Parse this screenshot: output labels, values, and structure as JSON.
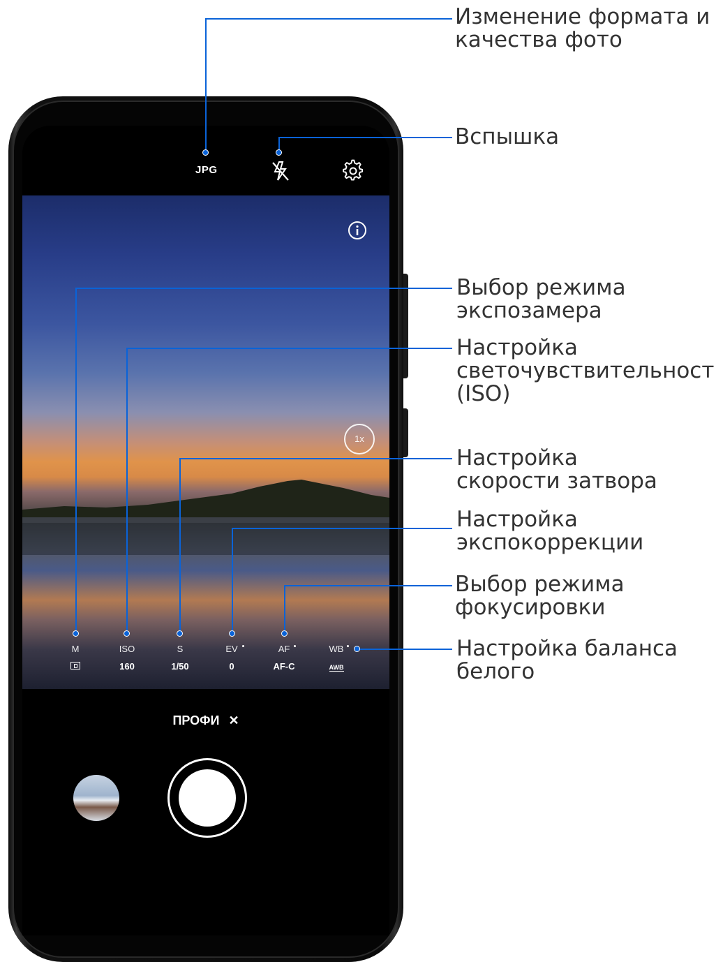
{
  "topbar": {
    "format": "JPG",
    "flash_icon": "flash-off-icon",
    "settings_icon": "gear-icon"
  },
  "viewfinder": {
    "info_icon": "info-icon",
    "zoom": "1x"
  },
  "params": [
    {
      "key": "metering",
      "label": "M",
      "value": "",
      "icon": "metering-icon"
    },
    {
      "key": "iso",
      "label": "ISO",
      "value": "160"
    },
    {
      "key": "shutter",
      "label": "S",
      "value": "1/50"
    },
    {
      "key": "ev",
      "label": "EV",
      "value": "0"
    },
    {
      "key": "af",
      "label": "AF",
      "value": "AF-C"
    },
    {
      "key": "wb",
      "label": "WB",
      "value": "",
      "icon": "awb-icon",
      "icon_text": "AWB"
    }
  ],
  "mode": {
    "label": "ПРОФИ",
    "close": "✕"
  },
  "callouts": {
    "format": "Изменение формата и\nкачества фото",
    "flash": "Вспышка",
    "metering": "Выбор режима\nэкспозамера",
    "iso": "Настройка\nсветочувствительности\n(ISO)",
    "shutter": "Настройка\nскорости затвора",
    "ev": "Настройка\nэкспокоррекции",
    "af": "Выбор режима\nфокусировки",
    "wb": "Настройка баланса\nбелого"
  },
  "colors": {
    "callout": "#0a63d8",
    "text": "#333333"
  }
}
